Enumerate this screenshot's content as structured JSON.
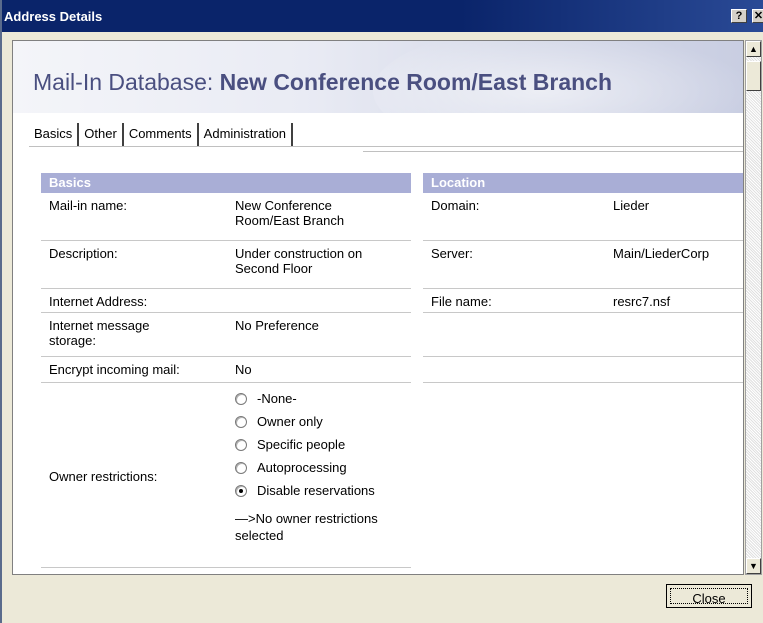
{
  "window": {
    "title": "Address Details",
    "help_button": "?",
    "close_button": "✕"
  },
  "banner": {
    "prefix": "Mail-In Database: ",
    "name": "New Conference Room/East Branch"
  },
  "tabs": [
    {
      "label": "Basics"
    },
    {
      "label": "Other"
    },
    {
      "label": "Comments"
    },
    {
      "label": "Administration"
    }
  ],
  "basics": {
    "header": "Basics",
    "rows": [
      {
        "label": "Mail-in name:",
        "value": "New Conference\nRoom/East Branch"
      },
      {
        "label": "Description:",
        "value": "Under construction on\nSecond Floor"
      },
      {
        "label": "Internet Address:",
        "value": ""
      },
      {
        "label": "Internet message\nstorage:",
        "value": "No Preference"
      },
      {
        "label": "Encrypt incoming mail:",
        "value": "No"
      }
    ],
    "owner_restrictions": {
      "label": "Owner restrictions:",
      "options": [
        "-None-",
        "Owner only",
        "Specific people",
        "Autoprocessing",
        "Disable reservations"
      ],
      "selected": "Disable reservations",
      "note": "—>No owner restrictions\nselected"
    }
  },
  "location": {
    "header": "Location",
    "rows": [
      {
        "label": "Domain:",
        "value": "Lieder"
      },
      {
        "label": "Server:",
        "value": "Main/LiederCorp"
      },
      {
        "label": "File name:",
        "value": "resrc7.nsf"
      }
    ]
  },
  "footer": {
    "close_label": "Close"
  },
  "colors": {
    "titlebar": "#0a246a",
    "section_header": "#a9aed6",
    "banner_text": "#4a4f80"
  }
}
